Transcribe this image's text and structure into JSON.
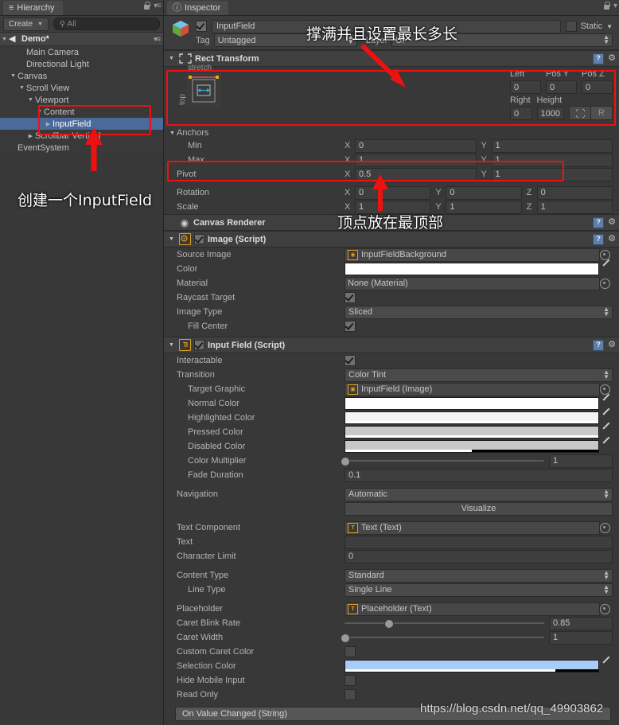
{
  "hierarchy": {
    "tab_label": "Hierarchy",
    "tab_icon": "list-icon",
    "create_label": "Create",
    "search_placeholder": "All",
    "scene_name": "Demo*",
    "items": [
      {
        "label": "Main Camera",
        "indent": 2,
        "arrow": "none",
        "selected": false
      },
      {
        "label": "Directional Light",
        "indent": 2,
        "arrow": "none",
        "selected": false
      },
      {
        "label": "Canvas",
        "indent": 1,
        "arrow": "open",
        "selected": false
      },
      {
        "label": "Scroll View",
        "indent": 2,
        "arrow": "open",
        "selected": false
      },
      {
        "label": "Viewport",
        "indent": 3,
        "arrow": "open",
        "selected": false
      },
      {
        "label": "Content",
        "indent": 4,
        "arrow": "open",
        "selected": false
      },
      {
        "label": "InputField",
        "indent": 5,
        "arrow": "closed",
        "selected": true
      },
      {
        "label": "Scrollbar Vertical",
        "indent": 3,
        "arrow": "closed",
        "selected": false
      },
      {
        "label": "EventSystem",
        "indent": 1,
        "arrow": "none",
        "selected": false
      }
    ]
  },
  "inspector": {
    "tab_label": "Inspector",
    "tab_icon": "info-icon",
    "object_name": "InputField",
    "enabled": true,
    "static_label": "Static",
    "static_checked": false,
    "tag_label": "Tag",
    "tag_value": "Untagged",
    "layer_label": "Layer",
    "layer_value": "UI"
  },
  "rect_transform": {
    "title": "Rect Transform",
    "preset_top_label": "top",
    "preset_stretch_label": "stretch",
    "blueprint_label": "R",
    "fields": {
      "left_label": "Left",
      "left_value": "0",
      "posy_label": "Pos Y",
      "posy_value": "0",
      "posz_label": "Pos Z",
      "posz_value": "0",
      "right_label": "Right",
      "right_value": "0",
      "height_label": "Height",
      "height_value": "1000"
    },
    "anchors_label": "Anchors",
    "min_label": "Min",
    "min_x": "0",
    "min_y": "1",
    "max_label": "Max",
    "max_x": "1",
    "max_y": "1",
    "pivot_label": "Pivot",
    "pivot_x": "0.5",
    "pivot_y": "1",
    "rotation_label": "Rotation",
    "rot_x": "0",
    "rot_y": "0",
    "rot_z": "0",
    "scale_label": "Scale",
    "scale_x": "1",
    "scale_y": "1",
    "scale_z": "1",
    "axis_x": "X",
    "axis_y": "Y",
    "axis_z": "Z"
  },
  "canvas_renderer": {
    "title": "Canvas Renderer",
    "icon": "eye-icon"
  },
  "image_script": {
    "title": "Image (Script)",
    "enabled": true,
    "source_image_label": "Source Image",
    "source_image_value": "InputFieldBackground",
    "color_label": "Color",
    "color_value": "#ffffff",
    "material_label": "Material",
    "material_value": "None (Material)",
    "raycast_label": "Raycast Target",
    "raycast_checked": true,
    "image_type_label": "Image Type",
    "image_type_value": "Sliced",
    "fill_center_label": "Fill Center",
    "fill_center_checked": true
  },
  "input_field_script": {
    "title": "Input Field (Script)",
    "enabled": true,
    "interactable_label": "Interactable",
    "interactable_checked": true,
    "transition_label": "Transition",
    "transition_value": "Color Tint",
    "target_graphic_label": "Target Graphic",
    "target_graphic_value": "InputField (Image)",
    "normal_color_label": "Normal Color",
    "normal_color_value": "#ffffff",
    "normal_color_alpha": 100,
    "highlighted_color_label": "Highlighted Color",
    "highlighted_color_value": "#f5f5f5",
    "highlighted_color_alpha": 100,
    "pressed_color_label": "Pressed Color",
    "pressed_color_value": "#c8c8c8",
    "pressed_color_alpha": 100,
    "disabled_color_label": "Disabled Color",
    "disabled_color_value": "#c8c8c8",
    "disabled_color_alpha": 50,
    "color_multiplier_label": "Color Multiplier",
    "color_multiplier_value": "1",
    "color_multiplier_pct": 0,
    "fade_duration_label": "Fade Duration",
    "fade_duration_value": "0.1",
    "navigation_label": "Navigation",
    "navigation_value": "Automatic",
    "visualize_label": "Visualize",
    "text_component_label": "Text Component",
    "text_component_value": "Text (Text)",
    "text_label": "Text",
    "text_value": "",
    "character_limit_label": "Character Limit",
    "character_limit_value": "0",
    "content_type_label": "Content Type",
    "content_type_value": "Standard",
    "line_type_label": "Line Type",
    "line_type_value": "Single Line",
    "placeholder_label": "Placeholder",
    "placeholder_value": "Placeholder (Text)",
    "caret_blink_label": "Caret Blink Rate",
    "caret_blink_value": "0.85",
    "caret_blink_pct": 22,
    "caret_width_label": "Caret Width",
    "caret_width_value": "1",
    "caret_width_pct": 0,
    "custom_caret_label": "Custom Caret Color",
    "custom_caret_checked": false,
    "selection_color_label": "Selection Color",
    "selection_color_value": "#a8cbf8",
    "selection_color_alpha": 83,
    "hide_mobile_label": "Hide Mobile Input",
    "hide_mobile_checked": false,
    "read_only_label": "Read Only",
    "read_only_checked": false,
    "on_value_changed_label": "On Value Changed (String)"
  },
  "annotations": {
    "note_header": "撑满并且设置最长多长",
    "note_hierarchy": "创建一个InputField",
    "note_pivot": "顶点放在最顶部",
    "watermark": "https://blog.csdn.net/qq_49903862",
    "highlight_color": "#ee1111"
  }
}
